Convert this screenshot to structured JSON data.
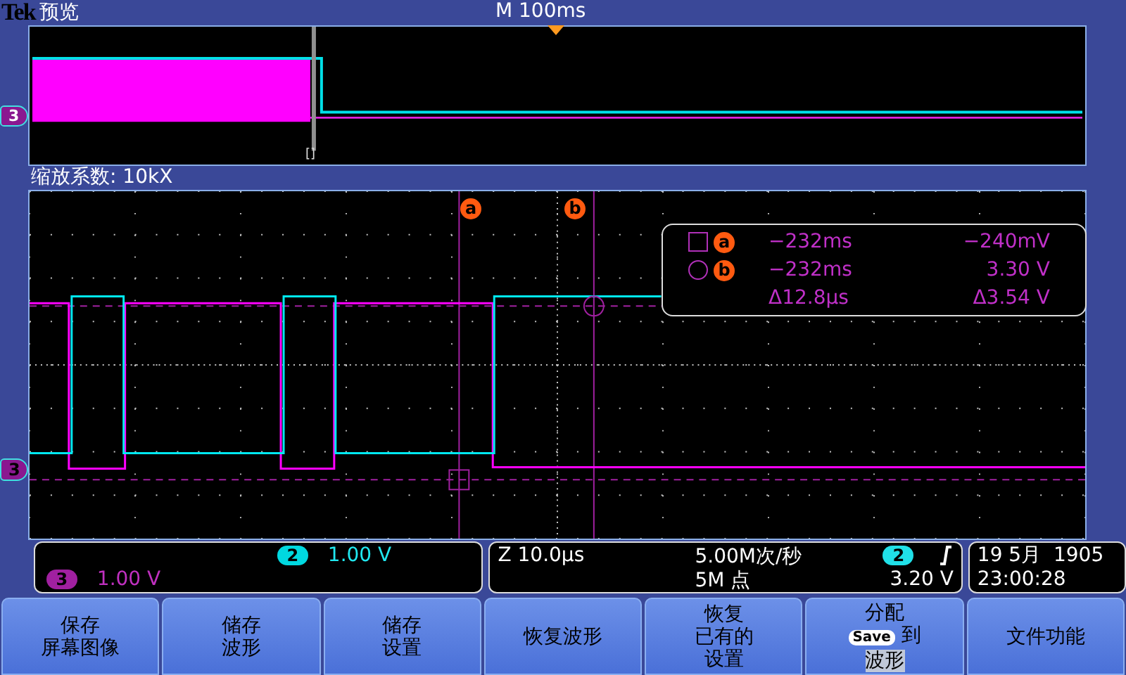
{
  "header": {
    "logo": "Tek",
    "title": "预览",
    "timebase": "M 100ms"
  },
  "overview": {
    "marker": "[]",
    "channel": "3"
  },
  "zoom_label": "缩放系数: 10kX",
  "graticule": {
    "channel": "3",
    "cursors": [
      {
        "label": "a"
      },
      {
        "label": "b"
      }
    ]
  },
  "cursor_readout": [
    {
      "kind": "square",
      "label": "a",
      "time": "−232ms",
      "value": "−240mV"
    },
    {
      "kind": "circle",
      "label": "b",
      "time": "−232ms",
      "value": "3.30 V"
    },
    {
      "kind": "delta",
      "time": "Δ12.8µs",
      "value": "Δ3.54 V"
    }
  ],
  "channels": [
    {
      "number": "2",
      "scale": "1.00 V",
      "color": "#00d8e0"
    },
    {
      "number": "3",
      "scale": "1.00 V",
      "color": "#a020a0"
    }
  ],
  "acquisition": {
    "zoom": "Z 10.0µs",
    "rate": "5.00M次/秒",
    "points": "5M 点",
    "trigger_source": "2",
    "trigger_level": "3.20 V"
  },
  "datetime": {
    "date": "19 5月  1905",
    "time": "23:00:28"
  },
  "buttons": [
    {
      "kind": "text",
      "lines": [
        "保存",
        "屏幕图像"
      ]
    },
    {
      "kind": "text",
      "lines": [
        "储存",
        "波形"
      ]
    },
    {
      "kind": "text",
      "lines": [
        "储存",
        "设置"
      ]
    },
    {
      "kind": "text",
      "lines": [
        "恢复波形"
      ]
    },
    {
      "kind": "text",
      "lines": [
        "恢复",
        "已有的",
        "设置"
      ]
    },
    {
      "kind": "assign",
      "lines": [
        "分配",
        "Save",
        "到",
        "波形"
      ]
    },
    {
      "kind": "text",
      "lines": [
        "文件功能"
      ]
    }
  ]
}
